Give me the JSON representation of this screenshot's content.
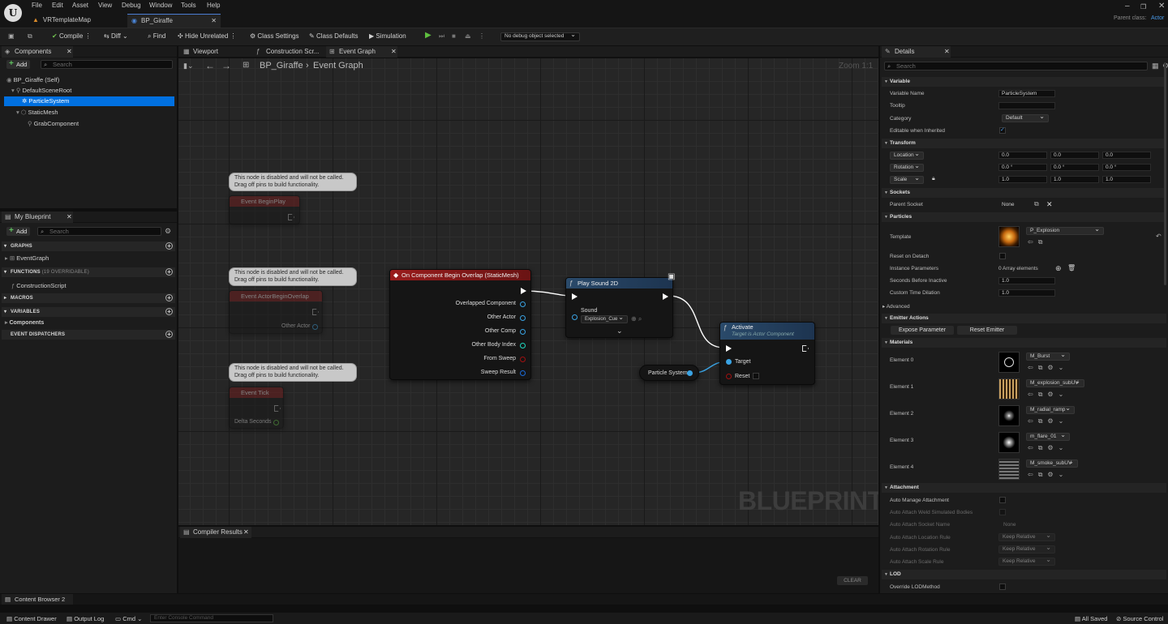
{
  "menu": [
    "File",
    "Edit",
    "Asset",
    "View",
    "Debug",
    "Window",
    "Tools",
    "Help"
  ],
  "doc_tabs": [
    "VRTemplateMap",
    "BP_Giraffe"
  ],
  "parent_class": {
    "label": "Parent class:",
    "value": "Actor"
  },
  "toolbar": {
    "compile": "Compile",
    "diff": "Diff",
    "find": "Find",
    "hide_unrelated": "Hide Unrelated",
    "class_settings": "Class Settings",
    "class_defaults": "Class Defaults",
    "simulation": "Simulation",
    "debug_object": "No debug object selected"
  },
  "components": {
    "tab": "Components",
    "add": "Add",
    "search": "Search",
    "items": [
      "BP_Giraffe (Self)",
      "DefaultSceneRoot",
      "ParticleSystem",
      "StaticMesh",
      "GrabComponent"
    ]
  },
  "my_blueprint": {
    "tab": "My Blueprint",
    "add": "Add",
    "search": "Search",
    "graphs": "GRAPHS",
    "event_graph": "EventGraph",
    "functions": "FUNCTIONS",
    "functions_count": "(19 OVERRIDABLE)",
    "construction_script": "ConstructionScript",
    "macros": "MACROS",
    "variables": "VARIABLES",
    "components": "Components",
    "event_dispatchers": "EVENT DISPATCHERS"
  },
  "graph_tabs": [
    "Viewport",
    "Construction Scr...",
    "Event Graph"
  ],
  "breadcrumb": {
    "blueprint": "BP_Giraffe",
    "graph": "Event Graph"
  },
  "zoom": "Zoom 1:1",
  "watermark": "BLUEPRINT",
  "disabled_comment": [
    "This node is disabled and will not be called.",
    "Drag off pins to build functionality."
  ],
  "nodes": {
    "begin_play": "Event BeginPlay",
    "actor_begin_overlap": "Event ActorBeginOverlap",
    "other_actor": "Other Actor",
    "tick": "Event Tick",
    "delta_seconds": "Delta Seconds",
    "overlap": {
      "title": "On Component Begin Overlap (StaticMesh)",
      "pins": [
        "Overlapped Component",
        "Other Actor",
        "Other Comp",
        "Other Body Index",
        "From Sweep",
        "Sweep Result"
      ]
    },
    "play_sound": {
      "title": "Play Sound 2D",
      "sound": "Sound",
      "sound_value": "Explosion_Cue"
    },
    "activate": {
      "title": "Activate",
      "subtitle": "Target is Actor Component",
      "target": "Target",
      "reset": "Reset"
    },
    "particle_var": "Particle System"
  },
  "compiler": {
    "tab": "Compiler Results",
    "clear": "CLEAR"
  },
  "details": {
    "tab": "Details",
    "search": "Search",
    "sections": [
      "Variable",
      "Transform",
      "Sockets",
      "Particles",
      "Advanced",
      "Emitter Actions",
      "Materials",
      "Attachment",
      "LOD"
    ],
    "variable_name": {
      "label": "Variable Name",
      "value": "ParticleSystem"
    },
    "tooltip": "Tooltip",
    "category": {
      "label": "Category",
      "value": "Default"
    },
    "editable": "Editable when Inherited",
    "location": {
      "label": "Location",
      "values": [
        "0.0",
        "0.0",
        "0.0"
      ]
    },
    "rotation": {
      "label": "Rotation",
      "values": [
        "0.0 °",
        "0.0 °",
        "0.0 °"
      ]
    },
    "scale": {
      "label": "Scale",
      "values": [
        "1.0",
        "1.0",
        "1.0"
      ]
    },
    "parent_socket": {
      "label": "Parent Socket",
      "value": "None"
    },
    "template": {
      "label": "Template",
      "value": "P_Explosion"
    },
    "reset_on_detach": "Reset on Detach",
    "instance_params": {
      "label": "Instance Parameters",
      "value": "0 Array elements"
    },
    "seconds_before_inactive": {
      "label": "Seconds Before Inactive",
      "value": "1.0"
    },
    "custom_time_dilation": {
      "label": "Custom Time Dilation",
      "value": "1.0"
    },
    "expose_parameter": "Expose Parameter",
    "reset_emitter": "Reset Emitter",
    "materials": [
      {
        "label": "Element 0",
        "value": "M_Burst"
      },
      {
        "label": "Element 1",
        "value": "M_explosion_subUV"
      },
      {
        "label": "Element 2",
        "value": "M_radial_ramp"
      },
      {
        "label": "Element 3",
        "value": "m_flare_01"
      },
      {
        "label": "Element 4",
        "value": "M_smoke_subUV"
      }
    ],
    "auto_manage": "Auto Manage Attachment",
    "auto_attach_weld": "Auto Attach Weld Simulated Bodies",
    "auto_attach_socket": {
      "label": "Auto Attach Socket Name",
      "value": "None"
    },
    "auto_attach_location": {
      "label": "Auto Attach Location Rule",
      "value": "Keep Relative"
    },
    "auto_attach_rotation": {
      "label": "Auto Attach Rotation Rule",
      "value": "Keep Relative"
    },
    "auto_attach_scale": {
      "label": "Auto Attach Scale Rule",
      "value": "Keep Relative"
    },
    "override_lod": "Override LODMethod"
  },
  "bottom": {
    "content_browser": "Content Browser 2",
    "content_drawer": "Content Drawer",
    "output_log": "Output Log",
    "cmd": "Cmd",
    "console": "Enter Console Command",
    "all_saved": "All Saved",
    "source_control": "Source Control"
  },
  "colors": {
    "accent": "#0070e0",
    "event_red": "#8a1a1a",
    "function_blue": "#2a4a6a",
    "exec_white": "#ffffff",
    "object_pin": "#3aa3e3"
  }
}
